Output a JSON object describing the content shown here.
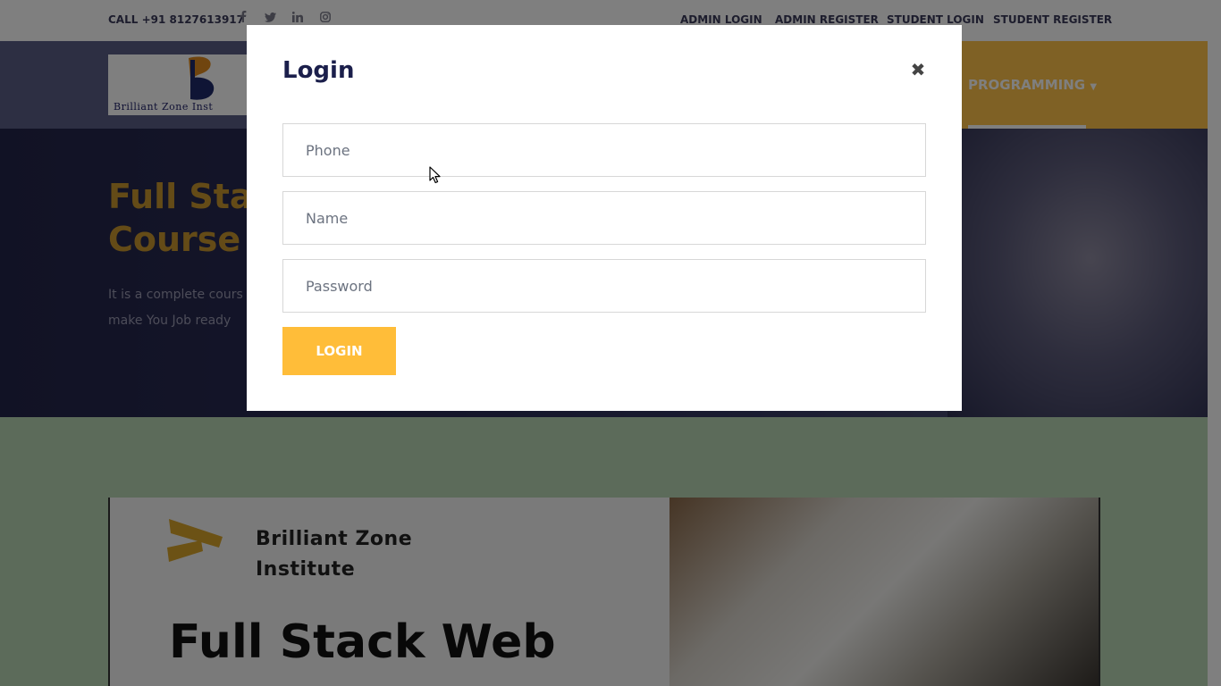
{
  "topbar": {
    "call": "CALL +91 8127613917",
    "social_icons": [
      "facebook-icon",
      "twitter-icon",
      "linkedin-icon",
      "instagram-icon"
    ],
    "links": [
      "ADMIN LOGIN",
      "ADMIN REGISTER",
      "STUDENT LOGIN",
      "STUDENT REGISTER"
    ]
  },
  "header": {
    "logo_text": "Brilliant Zone Inst",
    "menu_programming": "PROGRAMMING"
  },
  "hero": {
    "title_line1": "Full Stac",
    "title_line2": "Course",
    "text_line1": "It is a complete cours",
    "text_line2": "make You Job ready"
  },
  "banner": {
    "brand_line1": "Brilliant Zone",
    "brand_line2": "Institute",
    "title": "Full Stack Web"
  },
  "modal": {
    "title": "Login",
    "close_symbol": "✖",
    "phone_placeholder": "Phone",
    "name_placeholder": "Name",
    "password_placeholder": "Password",
    "login_label": "LOGIN"
  },
  "colors": {
    "accent": "#ffbd39",
    "header_bg": "#5a5f86",
    "modal_title": "#1b1f4b"
  }
}
